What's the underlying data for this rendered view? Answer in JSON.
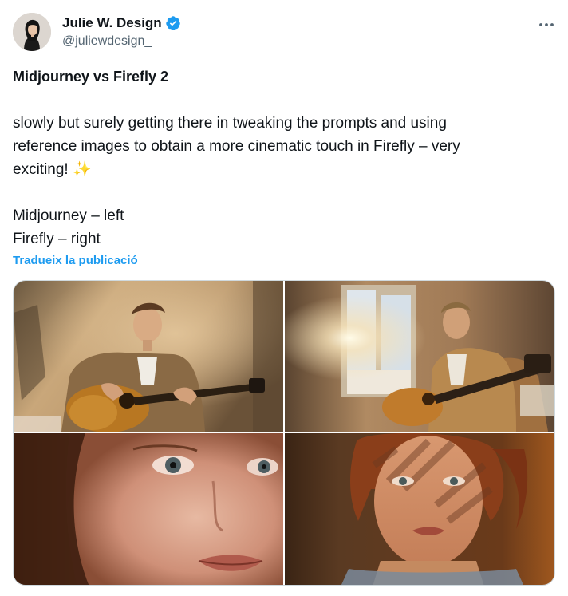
{
  "author": {
    "display_name": "Julie W. Design",
    "handle": "@juliewdesign_",
    "verified": true,
    "verified_color": "#1d9bf0"
  },
  "tweet": {
    "title": "Midjourney vs Firefly 2",
    "body_line_1": "slowly but surely getting there in tweaking the prompts and using",
    "body_line_2": "reference images to obtain a more cinematic touch in Firefly – very",
    "body_line_3": "exciting!",
    "body_emoji": "✨",
    "caption_left": "Midjourney – left",
    "caption_right": "Firefly – right",
    "translate_label": "Tradueix la publicació"
  },
  "media": {
    "images": [
      {
        "position": "top-left",
        "subject": "man-playing-guitar-midjourney"
      },
      {
        "position": "top-right",
        "subject": "man-playing-guitar-firefly"
      },
      {
        "position": "bottom-left",
        "subject": "woman-closeup-midjourney"
      },
      {
        "position": "bottom-right",
        "subject": "woman-closeup-firefly"
      }
    ]
  },
  "icons": {
    "more": "more-horizontal-icon",
    "verified": "verified-badge-icon"
  },
  "colors": {
    "text_primary": "#0f1419",
    "text_secondary": "#536471",
    "link": "#1d9bf0"
  }
}
